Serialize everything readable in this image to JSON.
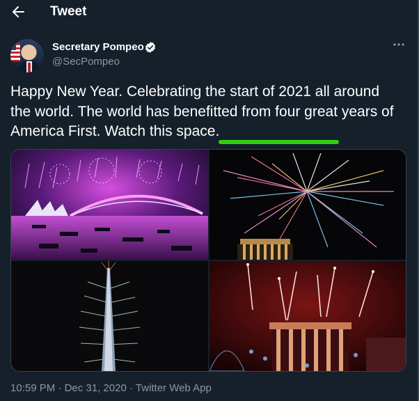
{
  "header": {
    "back_icon": "arrow-left-icon",
    "title": "Tweet"
  },
  "author": {
    "name": "Secretary Pompeo",
    "handle": "@SecPompeo",
    "verified_icon": "verified-badge-icon",
    "more_icon": "more-horizontal-icon"
  },
  "tweet": {
    "text_before_link": "Happy New Year. Celebrating the start of 2021 all around the world. The world has benefitted from four great years of America First. ",
    "link_text": "Watch this space",
    "text_after_link": ".",
    "highlight_color": "#2fd012"
  },
  "media": {
    "images": [
      "sydney-opera-house-fireworks-photo",
      "athens-acropolis-fireworks-photo",
      "burj-khalifa-fireworks-photo",
      "brandenburg-gate-fireworks-photo"
    ]
  },
  "footer": {
    "time": "10:59 PM",
    "separator1": " · ",
    "date": "Dec 31, 2020",
    "separator2": " · ",
    "source": "Twitter Web App"
  },
  "colors": {
    "background": "#15202b",
    "secondary_text": "#8b98a5",
    "border": "#38444d"
  }
}
